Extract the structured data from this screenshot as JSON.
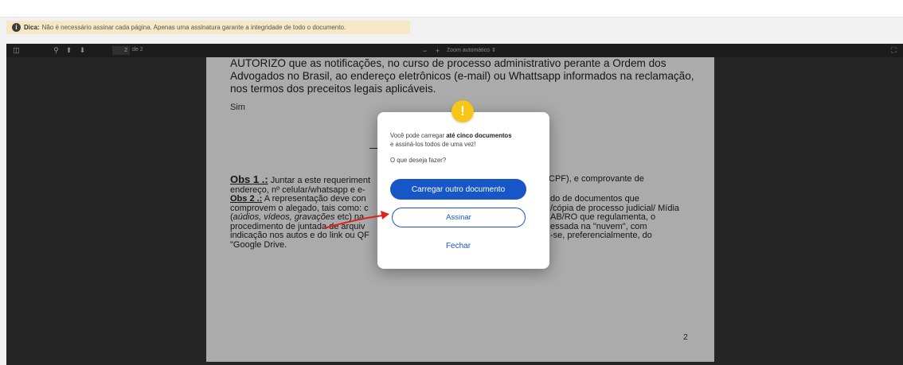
{
  "tip": {
    "label": "Dica:",
    "text": "Não é necessário assinar cada página. Apenas uma assinatura garante a integridade de todo o documento."
  },
  "toolbar": {
    "page_current": "2",
    "page_total": "de 2",
    "zoom": "Zoom automático"
  },
  "pdf": {
    "autorizo": "AUTORIZO que as notificações, no curso de processo administrativo perante a Ordem dos Advogados no Brasil, ao endereço eletrônicos (e-mail) ou Whattsapp informados na reclamação, nos termos dos  preceitos legais aplicáveis.",
    "sim": "Sim",
    "obs1_label": "Obs 1 .:",
    "obs1_text": " Juntar a este requeriment",
    "obs1_tail": "CPF), e comprovante de",
    "obs1_line2": "endereço, nº celular/whatsapp e e-",
    "obs2_label": "Obs 2 .:",
    "obs2_text": " A representação deve con",
    "obs2_tail": "do de documentos que",
    "line4_a": "comprovem o alegado, tais como: c",
    "line4_b": "/cópia de processo judicial/ Mídia",
    "line5_a": "(",
    "line5_i": "aúdios, vídeos, gravações",
    "line5_b": " etc) na",
    "line5_c": "AB/RO que regulamenta, o",
    "line6_a": "procedimento de juntada de arquiv",
    "line6_b": "essada na \"nuvem\", com",
    "line7_a": "indicação nos autos e do link ou QF",
    "line7_b": "-se, preferencialmente, do",
    "line8": "\"Google Drive.",
    "page_number": "2"
  },
  "dialog": {
    "badge": "!",
    "msg_pre": "Você pode carregar ",
    "msg_bold": "até cinco documentos",
    "msg_post": "e assiná-los todos de uma vez!",
    "question": "O que deseja fazer?",
    "btn_upload": "Carregar outro documento",
    "btn_sign": "Assinar",
    "btn_close": "Fechar"
  }
}
